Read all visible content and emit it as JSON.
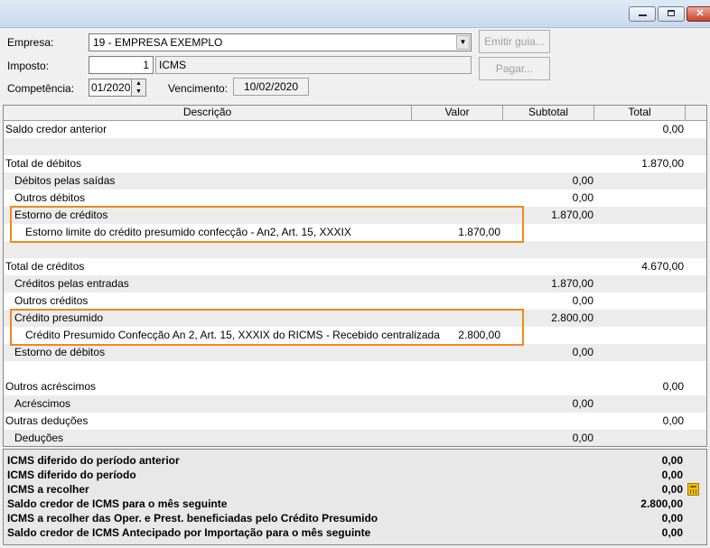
{
  "window": {
    "controls": {
      "minimize": "minimize",
      "maximize": "maximize",
      "close": "✕"
    }
  },
  "form": {
    "empresa_label": "Empresa:",
    "empresa_value": "19 - EMPRESA EXEMPLO",
    "imposto_label": "Imposto:",
    "imposto_code": "1",
    "imposto_name": "ICMS",
    "competencia_label": "Competência:",
    "competencia_value": "01/2020",
    "vencimento_label": "Vencimento:",
    "vencimento_value": "10/02/2020",
    "emitir_guia_label": "Emitir guia...",
    "pagar_label": "Pagar..."
  },
  "grid": {
    "headers": [
      "Descrição",
      "Valor",
      "Subtotal",
      "Total"
    ],
    "rows": [
      {
        "text": "Saldo credor anterior",
        "indent": 0,
        "valor": "",
        "subtotal": "",
        "total": "0,00",
        "alt": false
      },
      {
        "text": "",
        "indent": 0,
        "valor": "",
        "subtotal": "",
        "total": "",
        "alt": true
      },
      {
        "text": "Total de débitos",
        "indent": 0,
        "valor": "",
        "subtotal": "",
        "total": "1.870,00",
        "alt": false
      },
      {
        "text": "Débitos pelas saídas",
        "indent": 1,
        "valor": "",
        "subtotal": "0,00",
        "total": "",
        "alt": true
      },
      {
        "text": "Outros débitos",
        "indent": 1,
        "valor": "",
        "subtotal": "0,00",
        "total": "",
        "alt": false
      },
      {
        "text": "Estorno de créditos",
        "indent": 1,
        "valor": "",
        "subtotal": "1.870,00",
        "total": "",
        "alt": true
      },
      {
        "text": "Estorno limite do crédito presumido confecção - An2, Art. 15, XXXIX",
        "indent": 2,
        "valor": "1.870,00",
        "subtotal": "",
        "total": "",
        "alt": false
      },
      {
        "text": "",
        "indent": 0,
        "valor": "",
        "subtotal": "",
        "total": "",
        "alt": true
      },
      {
        "text": "Total de créditos",
        "indent": 0,
        "valor": "",
        "subtotal": "",
        "total": "4.670,00",
        "alt": false
      },
      {
        "text": "Créditos pelas entradas",
        "indent": 1,
        "valor": "",
        "subtotal": "1.870,00",
        "total": "",
        "alt": true
      },
      {
        "text": "Outros créditos",
        "indent": 1,
        "valor": "",
        "subtotal": "0,00",
        "total": "",
        "alt": false
      },
      {
        "text": "Crédito presumido",
        "indent": 1,
        "valor": "",
        "subtotal": "2.800,00",
        "total": "",
        "alt": true
      },
      {
        "text": "Crédito Presumido Confecção An 2, Art. 15, XXXIX do RICMS - Recebido centralizada",
        "indent": 2,
        "valor": "2.800,00",
        "subtotal": "",
        "total": "",
        "alt": false
      },
      {
        "text": "Estorno de débitos",
        "indent": 1,
        "valor": "",
        "subtotal": "0,00",
        "total": "",
        "alt": true
      },
      {
        "text": "",
        "indent": 0,
        "valor": "",
        "subtotal": "",
        "total": "",
        "alt": false
      },
      {
        "text": "Outros acréscimos",
        "indent": 0,
        "valor": "",
        "subtotal": "",
        "total": "0,00",
        "alt": false
      },
      {
        "text": "Acréscimos",
        "indent": 1,
        "valor": "",
        "subtotal": "0,00",
        "total": "",
        "alt": true
      },
      {
        "text": "Outras deduções",
        "indent": 0,
        "valor": "",
        "subtotal": "",
        "total": "0,00",
        "alt": false
      },
      {
        "text": "Deduções",
        "indent": 1,
        "valor": "",
        "subtotal": "0,00",
        "total": "",
        "alt": true
      }
    ]
  },
  "summary": [
    {
      "label": "ICMS diferido do período anterior",
      "value": "0,00"
    },
    {
      "label": "ICMS diferido do período",
      "value": "0,00"
    },
    {
      "label": "ICMS a recolher",
      "value": "0,00"
    },
    {
      "label": "Saldo credor de ICMS para o mês seguinte",
      "value": "2.800,00"
    },
    {
      "label": "ICMS a recolher das Oper. e Prest. beneficiadas pelo Crédito Presumido",
      "value": "0,00"
    },
    {
      "label": "Saldo credor de ICMS Antecipado por Importação para o mês seguinte",
      "value": "0,00"
    }
  ],
  "colors": {
    "highlight": "#f0891c",
    "alt_row": "#ececec"
  }
}
